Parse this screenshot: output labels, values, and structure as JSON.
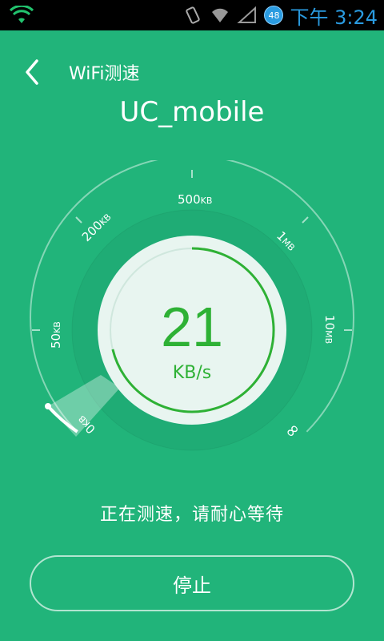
{
  "status_bar": {
    "time": "下午 3:24",
    "battery": "48",
    "icons": [
      "wifi-icon",
      "vibrate-icon",
      "wifi-signal-icon",
      "cell-signal-icon",
      "battery-icon"
    ]
  },
  "header": {
    "title": "WiFi测速",
    "back_icon": "chevron-left-icon"
  },
  "network": {
    "ssid": "UC_mobile"
  },
  "gauge": {
    "ticks": [
      {
        "value": "0",
        "unit": "KB"
      },
      {
        "value": "50",
        "unit": "KB"
      },
      {
        "value": "200",
        "unit": "KB"
      },
      {
        "value": "500",
        "unit": "KB"
      },
      {
        "value": "1",
        "unit": "MB"
      },
      {
        "value": "10",
        "unit": "MB"
      },
      {
        "value": "∞",
        "unit": ""
      }
    ],
    "progress": 0.02
  },
  "speed": {
    "value": "21",
    "unit": "KB/s"
  },
  "status_text": "正在测速，请耐心等待",
  "stop_label": "停止",
  "colors": {
    "background": "#21b47a",
    "accent": "#2eb135",
    "dial": "#e8f5f0"
  }
}
